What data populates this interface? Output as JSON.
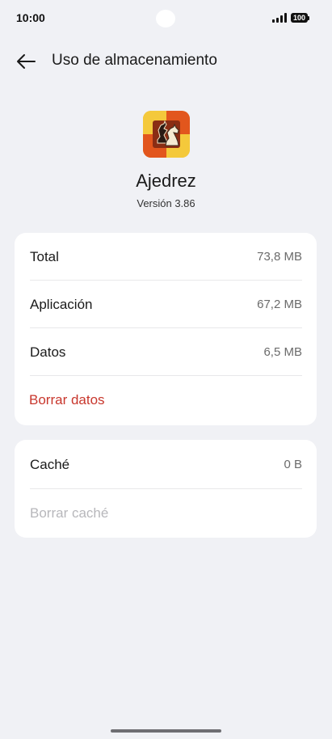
{
  "status_bar": {
    "time": "10:00",
    "battery": "100"
  },
  "header": {
    "title": "Uso de almacenamiento",
    "back_icon": "arrow-left-icon"
  },
  "app": {
    "name": "Ajedrez",
    "version": "Versión 3.86",
    "icon": "chess-knight-icon"
  },
  "storage": {
    "rows": [
      {
        "label": "Total",
        "value": "73,8 MB"
      },
      {
        "label": "Aplicación",
        "value": "67,2 MB"
      },
      {
        "label": "Datos",
        "value": "6,5 MB"
      }
    ],
    "clear_data_label": "Borrar datos"
  },
  "cache": {
    "label": "Caché",
    "value": "0 B",
    "clear_cache_label": "Borrar caché"
  },
  "colors": {
    "background": "#f0f1f5",
    "card": "#ffffff",
    "destructive": "#c8372d",
    "disabled": "#b7b7bb"
  }
}
